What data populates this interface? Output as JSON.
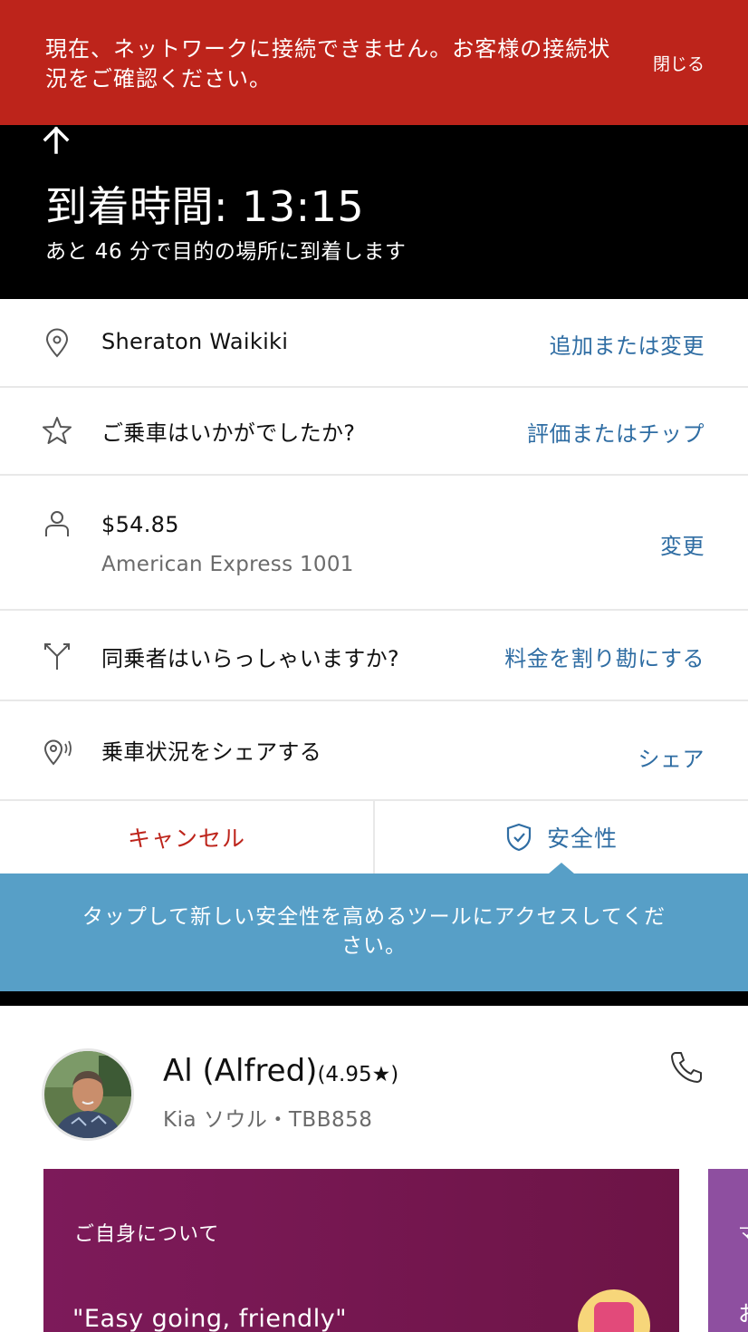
{
  "banner": {
    "message": "現在、ネットワークに接続できません。お客様の接続状況をご確認ください。",
    "close_label": "閉じる"
  },
  "eta": {
    "title": "到着時間: 13:15",
    "subtitle": "あと 46 分で目的の場所に到着します"
  },
  "rows": {
    "destination": {
      "icon": "location-pin-icon",
      "label": "Sheraton Waikiki",
      "action": "追加または変更"
    },
    "rating": {
      "icon": "star-icon",
      "label": "ご乗車はいかがでしたか?",
      "action": "評価またはチップ"
    },
    "payment": {
      "icon": "person-icon",
      "amount": "$54.85",
      "method": "American Express 1001",
      "action": "変更"
    },
    "split": {
      "icon": "split-fork-icon",
      "label": "同乗者はいらっしゃいますか?",
      "action": "料金を割り勘にする"
    },
    "share": {
      "icon": "share-location-icon",
      "label": "乗車状況をシェアする",
      "action": "シェア"
    }
  },
  "buttons": {
    "cancel": "キャンセル",
    "safety": "安全性",
    "safety_icon": "shield-check-icon"
  },
  "tooltip": {
    "text": "タップして新しい安全性を高めるツールにアクセスしてください。"
  },
  "driver": {
    "name": "Al (Alfred)",
    "rating": "(4.95★)",
    "vehicle": "Kia ソウル・TBB858",
    "phone_icon": "phone-icon"
  },
  "cards": {
    "about_title": "ご自身について",
    "about_quote": "\"Easy going, friendly\"",
    "next_title_partial": "マ",
    "next_text_partial": "お"
  },
  "colors": {
    "banner_red": "#bd241b",
    "link_blue": "#2f6da3",
    "tooltip_blue": "#579fc7",
    "card_purple": "#7d1a5a"
  }
}
